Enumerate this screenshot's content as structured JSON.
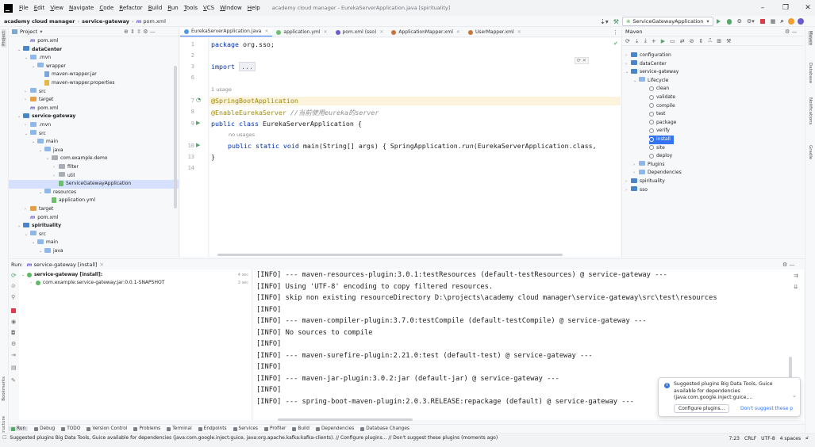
{
  "menubar": {
    "items": [
      "File",
      "Edit",
      "View",
      "Navigate",
      "Code",
      "Refactor",
      "Build",
      "Run",
      "Tools",
      "VCS",
      "Window",
      "Help"
    ],
    "window_title": "academy cloud manager - EurekaServerApplication.java [spirituality]"
  },
  "navbar": {
    "project": "academy cloud manager",
    "module": "service-gateway",
    "file": "pom.xml",
    "run_config": "ServiceGatewayApplication"
  },
  "project_panel": {
    "title": "Project",
    "items": [
      {
        "label": "pom.xml",
        "depth": 2,
        "icon": "pom"
      },
      {
        "label": "dataCenter",
        "depth": 1,
        "icon": "module",
        "arrow": "down",
        "bold": true
      },
      {
        "label": ".mvn",
        "depth": 2,
        "icon": "folder",
        "arrow": "down"
      },
      {
        "label": "wrapper",
        "depth": 3,
        "icon": "folder",
        "arrow": "down"
      },
      {
        "label": "maven-wrapper.jar",
        "depth": 4,
        "icon": "file"
      },
      {
        "label": "maven-wrapper.properties",
        "depth": 4,
        "icon": "prop"
      },
      {
        "label": "src",
        "depth": 2,
        "icon": "folder",
        "arrow": "right"
      },
      {
        "label": "target",
        "depth": 2,
        "icon": "orange",
        "arrow": "right"
      },
      {
        "label": "pom.xml",
        "depth": 2,
        "icon": "pom"
      },
      {
        "label": "service-gateway",
        "depth": 1,
        "icon": "module",
        "arrow": "down",
        "bold": true
      },
      {
        "label": ".mvn",
        "depth": 2,
        "icon": "folder",
        "arrow": "right"
      },
      {
        "label": "src",
        "depth": 2,
        "icon": "folder",
        "arrow": "down"
      },
      {
        "label": "main",
        "depth": 3,
        "icon": "folder",
        "arrow": "down"
      },
      {
        "label": "java",
        "depth": 4,
        "icon": "folder",
        "arrow": "down"
      },
      {
        "label": "com.example.demo",
        "depth": 5,
        "icon": "plain",
        "arrow": "down"
      },
      {
        "label": "filter",
        "depth": 6,
        "icon": "plain",
        "arrow": "right"
      },
      {
        "label": "util",
        "depth": 6,
        "icon": "plain",
        "arrow": "right"
      },
      {
        "label": "ServiceGatewayApplication",
        "depth": 6,
        "icon": "yml",
        "selected": true
      },
      {
        "label": "resources",
        "depth": 4,
        "icon": "folder",
        "arrow": "down"
      },
      {
        "label": "application.yml",
        "depth": 5,
        "icon": "yml"
      },
      {
        "label": "target",
        "depth": 2,
        "icon": "orange",
        "arrow": "right"
      },
      {
        "label": "pom.xml",
        "depth": 2,
        "icon": "pom"
      },
      {
        "label": "spirituality",
        "depth": 1,
        "icon": "module",
        "arrow": "down",
        "bold": true
      },
      {
        "label": "src",
        "depth": 2,
        "icon": "folder",
        "arrow": "down"
      },
      {
        "label": "main",
        "depth": 3,
        "icon": "folder",
        "arrow": "down"
      },
      {
        "label": "java",
        "depth": 4,
        "icon": "folder",
        "arrow": "down"
      }
    ]
  },
  "editor": {
    "tabs": [
      {
        "label": "EurekaServerApplication.java",
        "active": true
      },
      {
        "label": "application.yml"
      },
      {
        "label": "pom.xml (sso)"
      },
      {
        "label": "ApplicationMapper.xml"
      },
      {
        "label": "UserMapper.xml"
      }
    ],
    "line_numbers": [
      "1",
      "2",
      "3",
      "6",
      "",
      "7",
      "8",
      "9",
      "",
      "10",
      "13",
      "14"
    ],
    "code": {
      "package_kw": "package",
      "package_name": " org.sso;",
      "import_kw": "import",
      "import_fold": "...",
      "usage_hint": "1 usage",
      "annotation1": "@SpringBootApplication",
      "annotation2": "@EnableEurekaServer",
      "comment2": " //当前使用eureka的server",
      "class_decl_kw": "public class",
      "class_name": " EurekaServerApplication {",
      "no_usages": "no usages",
      "main_kw": "public static void",
      "main_sig": " main(String[] args) { SpringApplication.",
      "run_method": "run",
      "main_tail": "(EurekaServerApplication.class,",
      "close": "}"
    }
  },
  "maven": {
    "title": "Maven",
    "items": [
      {
        "label": "configuration",
        "depth": 0,
        "arrow": "right"
      },
      {
        "label": "dataCenter",
        "depth": 0,
        "arrow": "right"
      },
      {
        "label": "service-gateway",
        "depth": 0,
        "arrow": "down"
      },
      {
        "label": "Lifecycle",
        "depth": 1,
        "arrow": "down"
      },
      {
        "label": "clean",
        "depth": 2,
        "gear": true
      },
      {
        "label": "validate",
        "depth": 2,
        "gear": true
      },
      {
        "label": "compile",
        "depth": 2,
        "gear": true
      },
      {
        "label": "test",
        "depth": 2,
        "gear": true
      },
      {
        "label": "package",
        "depth": 2,
        "gear": true
      },
      {
        "label": "verify",
        "depth": 2,
        "gear": true
      },
      {
        "label": "install",
        "depth": 2,
        "gear": true,
        "selected": true
      },
      {
        "label": "site",
        "depth": 2,
        "gear": true
      },
      {
        "label": "deploy",
        "depth": 2,
        "gear": true
      },
      {
        "label": "Plugins",
        "depth": 1,
        "arrow": "right"
      },
      {
        "label": "Dependencies",
        "depth": 1,
        "arrow": "right"
      },
      {
        "label": "spirituality",
        "depth": 0,
        "arrow": "right"
      },
      {
        "label": "sso",
        "depth": 0,
        "arrow": "right"
      }
    ]
  },
  "run": {
    "label": "Run:",
    "tab": "service-gateway [install]",
    "tree": [
      {
        "label": "service-gateway [install]:",
        "time": "4 sec",
        "bold": true
      },
      {
        "label": "com.example:service-gateway:jar:0.0.1-SNAPSHOT",
        "time": "3 sec"
      }
    ],
    "console": [
      "[INFO] --- maven-resources-plugin:3.0.1:testResources (default-testResources) @ service-gateway ---",
      "[INFO] Using 'UTF-8' encoding to copy filtered resources.",
      "[INFO] skip non existing resourceDirectory D:\\projects\\academy cloud manager\\service-gateway\\src\\test\\resources",
      "[INFO]",
      "[INFO] --- maven-compiler-plugin:3.7.0:testCompile (default-testCompile) @ service-gateway ---",
      "[INFO] No sources to compile",
      "[INFO]",
      "[INFO] --- maven-surefire-plugin:2.21.0:test (default-test) @ service-gateway ---",
      "[INFO]",
      "[INFO] --- maven-jar-plugin:3.0.2:jar (default-jar) @ service-gateway ---",
      "[INFO]",
      "[INFO] --- spring-boot-maven-plugin:2.0.3.RELEASE:repackage (default) @ service-gateway ---"
    ]
  },
  "notification": {
    "line1": "Suggested plugins Big Data Tools, Guice",
    "line2": "available for dependencies",
    "line3": "(java:com.google.inject:guice,...",
    "configure": "Configure plugins...",
    "dismiss": "Don't suggest these p"
  },
  "tool_tabs": [
    "Run",
    "Debug",
    "TODO",
    "Version Control",
    "Problems",
    "Terminal",
    "Endpoints",
    "Services",
    "Profiler",
    "Build",
    "Dependencies",
    "Database Changes"
  ],
  "left_strip": {
    "project": "Project",
    "bookmarks": "Bookmarks",
    "structure": "Structure"
  },
  "right_strip": {
    "maven": "Maven",
    "database": "Database",
    "notifications": "Notifications",
    "gradle": "Gradle"
  },
  "status": {
    "message": "Suggested plugins Big Data Tools, Guice available for dependencies (java:com.google.inject:guice, java:org.apache.kafka:kafka-clients). // Configure plugins... // Don't suggest these plugins (moments ago)",
    "position": "7:23",
    "line_sep": "CRLF",
    "encoding": "UTF-8",
    "indent": "4 spaces"
  },
  "colors": {
    "accent": "#3574f0",
    "selection": "#d5e1ff",
    "run_green": "#55a76a",
    "stop_red": "#db3b4b"
  }
}
